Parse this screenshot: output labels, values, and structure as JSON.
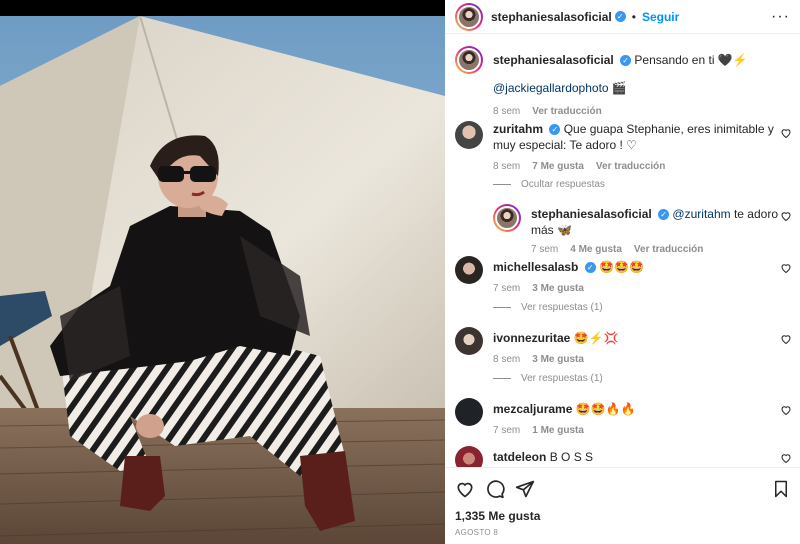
{
  "post": {
    "author": "stephaniesalasoficial",
    "follow_label": "Seguir",
    "more_label": "···"
  },
  "caption": {
    "author": "stephaniesalasoficial",
    "text": "Pensando en ti 🖤⚡",
    "mention": "@jackiegallardophoto 🎬",
    "time": "8 sem",
    "translate": "Ver traducción"
  },
  "comments": [
    {
      "author": "zuritahm",
      "text": "Que guapa Stephanie, eres inimitable y muy especial: Te adoro ! ♡",
      "time": "8 sem",
      "likes": "7 Me gusta",
      "translate": "Ver traducción",
      "replies_label": "Ocultar respuestas",
      "reply": {
        "author": "stephaniesalasoficial",
        "mention": "@zuritahm",
        "text": " te adoro más 🦋",
        "time": "7 sem",
        "likes": "4 Me gusta",
        "translate": "Ver traducción"
      }
    },
    {
      "author": "michellesalasb",
      "text": "🤩🤩🤩",
      "time": "7 sem",
      "likes": "3 Me gusta",
      "replies_label": "Ver respuestas (1)"
    },
    {
      "author": "ivonnezuritae",
      "text": "🤩⚡💢",
      "time": "8 sem",
      "likes": "3 Me gusta",
      "replies_label": "Ver respuestas (1)"
    },
    {
      "author": "mezcaljurame",
      "text": "🤩🤩🔥🔥",
      "time": "7 sem",
      "likes": "1 Me gusta"
    },
    {
      "author": "tatdeleon",
      "text": "B O S S"
    }
  ],
  "stats": {
    "likes": "1,335 Me gusta",
    "date": "AGOSTO 8"
  },
  "colors": {
    "link": "#00376b",
    "follow": "#0095f6",
    "verified": "#3897f0",
    "muted": "#8e8e8e"
  }
}
